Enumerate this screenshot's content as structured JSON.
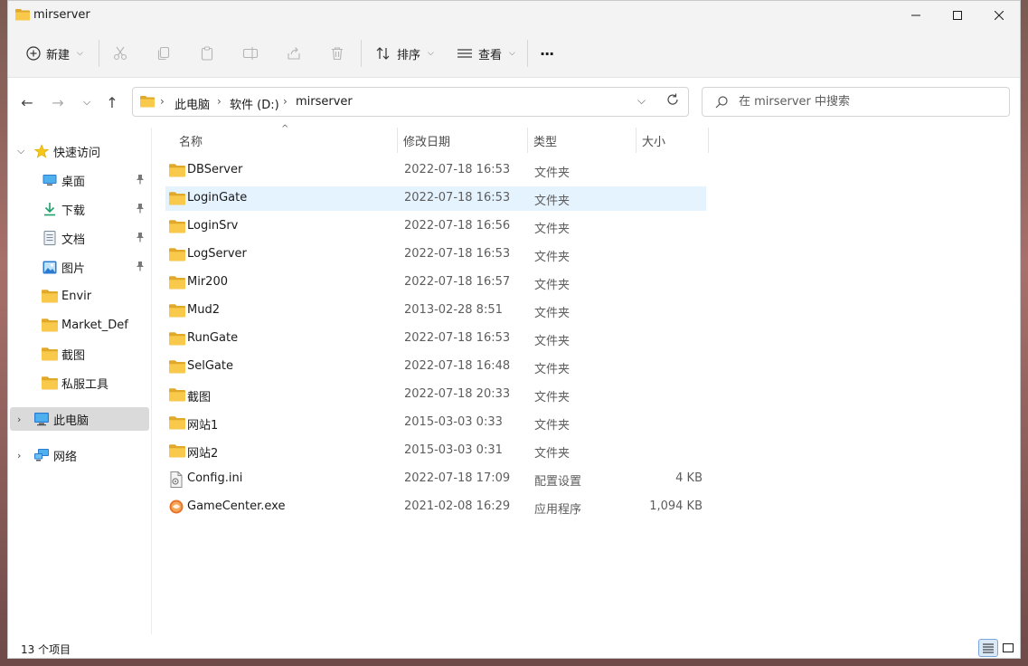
{
  "window": {
    "title": "mirserver"
  },
  "toolbar": {
    "new_label": "新建",
    "sort_label": "排序",
    "view_label": "查看",
    "more_label": "···"
  },
  "address": {
    "crumbs": [
      "此电脑",
      "软件 (D:)",
      "mirserver"
    ]
  },
  "search": {
    "placeholder": "在 mirserver 中搜索"
  },
  "sidebar": {
    "quick_access": "快速访问",
    "items": [
      {
        "label": "桌面",
        "icon": "desktop-icon",
        "pinned": true
      },
      {
        "label": "下载",
        "icon": "download-icon",
        "pinned": true
      },
      {
        "label": "文档",
        "icon": "document-icon",
        "pinned": true
      },
      {
        "label": "图片",
        "icon": "picture-icon",
        "pinned": true
      },
      {
        "label": "Envir",
        "icon": "folder-icon",
        "pinned": false
      },
      {
        "label": "Market_Def",
        "icon": "folder-icon",
        "pinned": false
      },
      {
        "label": "截图",
        "icon": "folder-icon",
        "pinned": false
      },
      {
        "label": "私服工具",
        "icon": "folder-icon",
        "pinned": false
      }
    ],
    "this_pc": "此电脑",
    "network": "网络"
  },
  "columns": {
    "name": "名称",
    "date": "修改日期",
    "type": "类型",
    "size": "大小"
  },
  "files": [
    {
      "name": "DBServer",
      "date": "2022-07-18 16:53",
      "type": "文件夹",
      "size": "",
      "icon": "folder-icon"
    },
    {
      "name": "LoginGate",
      "date": "2022-07-18 16:53",
      "type": "文件夹",
      "size": "",
      "icon": "folder-icon",
      "selected": true
    },
    {
      "name": "LoginSrv",
      "date": "2022-07-18 16:56",
      "type": "文件夹",
      "size": "",
      "icon": "folder-icon"
    },
    {
      "name": "LogServer",
      "date": "2022-07-18 16:53",
      "type": "文件夹",
      "size": "",
      "icon": "folder-icon"
    },
    {
      "name": "Mir200",
      "date": "2022-07-18 16:57",
      "type": "文件夹",
      "size": "",
      "icon": "folder-icon"
    },
    {
      "name": "Mud2",
      "date": "2013-02-28 8:51",
      "type": "文件夹",
      "size": "",
      "icon": "folder-icon"
    },
    {
      "name": "RunGate",
      "date": "2022-07-18 16:53",
      "type": "文件夹",
      "size": "",
      "icon": "folder-icon"
    },
    {
      "name": "SelGate",
      "date": "2022-07-18 16:48",
      "type": "文件夹",
      "size": "",
      "icon": "folder-icon"
    },
    {
      "name": "截图",
      "date": "2022-07-18 20:33",
      "type": "文件夹",
      "size": "",
      "icon": "folder-icon"
    },
    {
      "name": "网站1",
      "date": "2015-03-03 0:33",
      "type": "文件夹",
      "size": "",
      "icon": "folder-icon"
    },
    {
      "name": "网站2",
      "date": "2015-03-03 0:31",
      "type": "文件夹",
      "size": "",
      "icon": "folder-icon"
    },
    {
      "name": "Config.ini",
      "date": "2022-07-18 17:09",
      "type": "配置设置",
      "size": "4 KB",
      "icon": "ini-file-icon"
    },
    {
      "name": "GameCenter.exe",
      "date": "2021-02-08 16:29",
      "type": "应用程序",
      "size": "1,094 KB",
      "icon": "app-exe-icon"
    }
  ],
  "status": {
    "item_count": "13 个项目"
  },
  "colors": {
    "folder": "#f8c94b",
    "folder_dark": "#e0a92a",
    "selected_row": "#e5f3ff",
    "accent": "#0067c0"
  }
}
